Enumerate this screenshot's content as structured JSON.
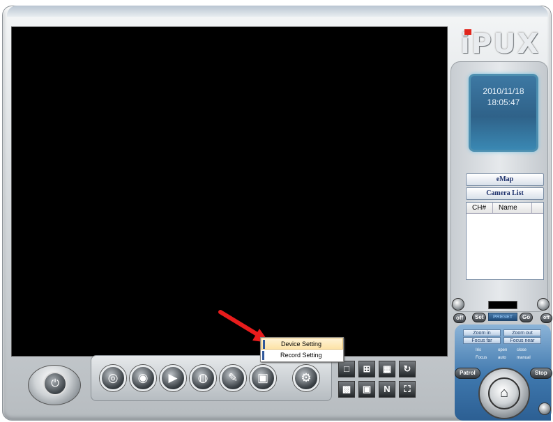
{
  "brand": {
    "logo_text": "iPUX"
  },
  "clock": {
    "date": "2010/11/18",
    "time": "18:05:47"
  },
  "side_panel": {
    "emap_label": "eMap",
    "camera_list_label": "Camera List",
    "columns": [
      "CH#",
      "Name"
    ]
  },
  "ptz": {
    "off_left": "off",
    "off_right": "off",
    "set_label": "Set",
    "preset_label": "PRESET",
    "go_label": "Go",
    "zoom_in": "Zoom in",
    "zoom_out": "Zoom out",
    "focus_far": "Focus far",
    "focus_near": "Focus near",
    "iris_label": "Iris",
    "open_label": "open",
    "close_label": "close",
    "focus_label": "Focus",
    "auto_label": "auto",
    "manual_label": "manual",
    "patrol_label": "Patrol",
    "stop_label": "Stop"
  },
  "context_menu": {
    "items": [
      {
        "label": "Device Setting",
        "highlighted": true
      },
      {
        "label": "Record Setting",
        "highlighted": false
      }
    ]
  },
  "colors": {
    "arrow": "#e81c1c",
    "clock_bg": "#2f6289"
  }
}
